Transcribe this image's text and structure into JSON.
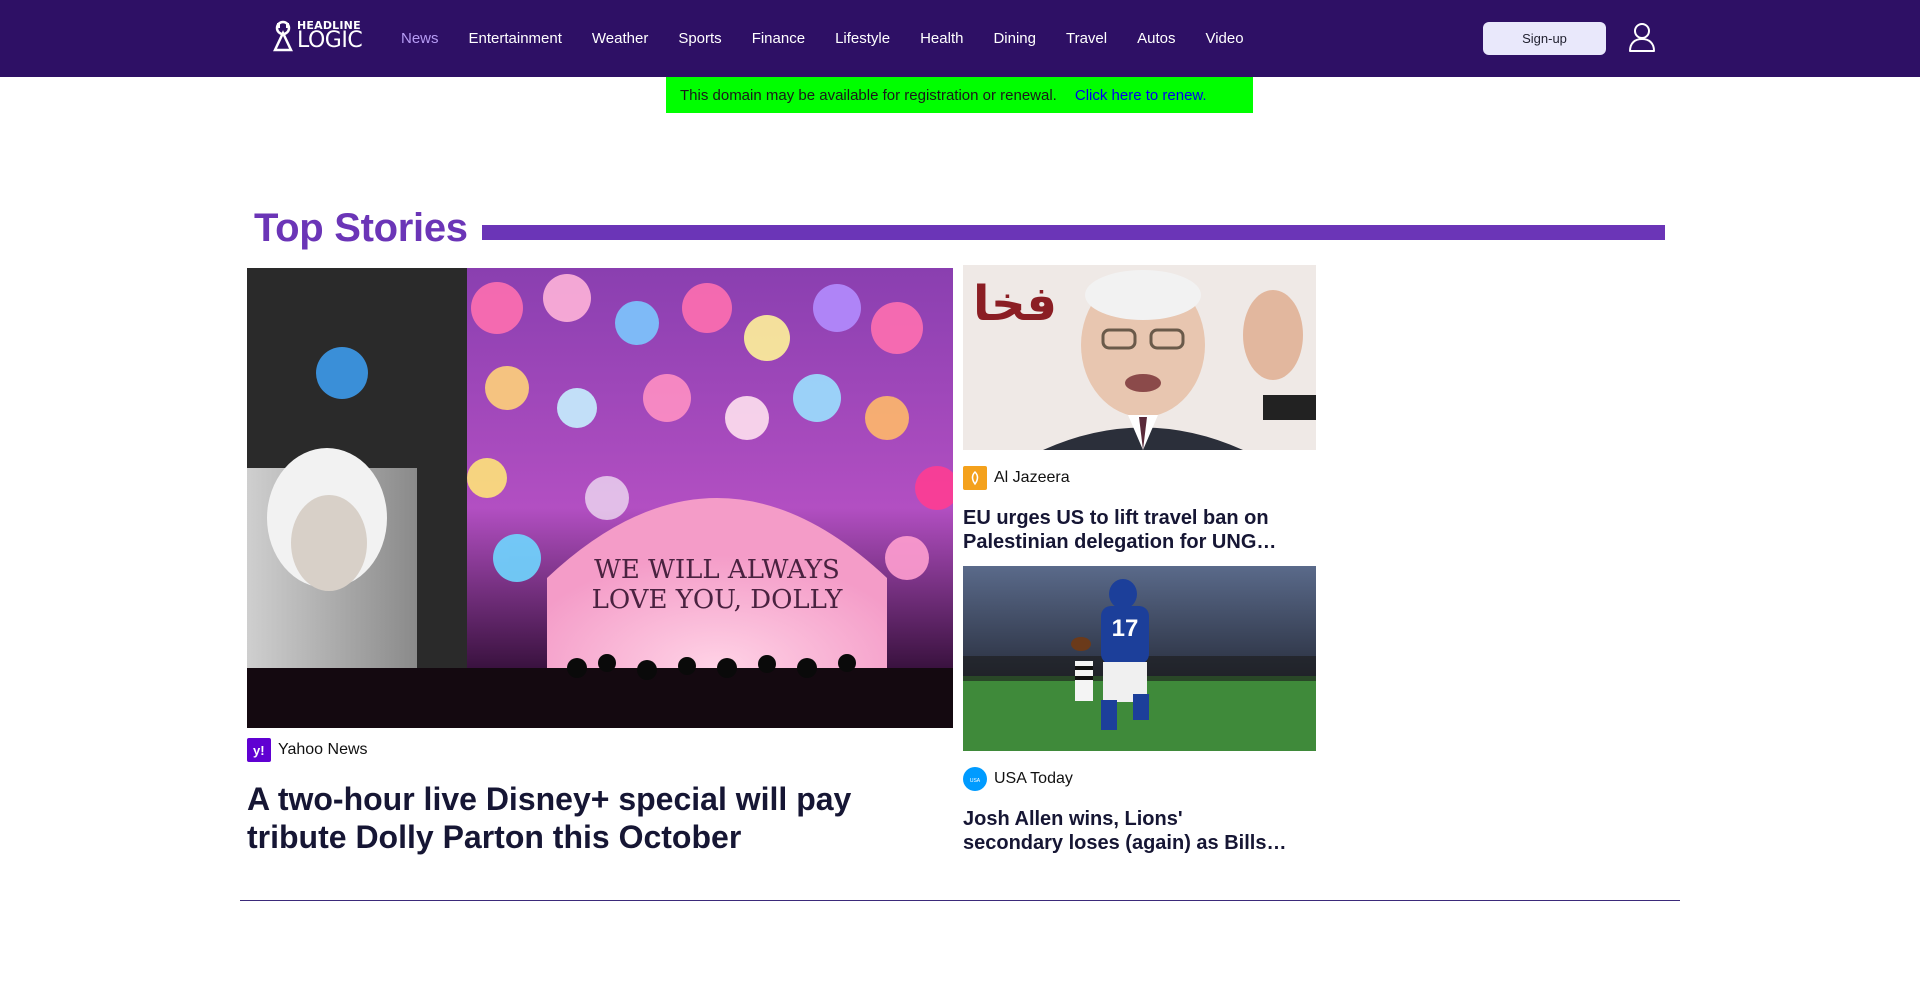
{
  "header": {
    "logo_top": "HEADLINE",
    "logo_bottom": "LOGIC",
    "nav": [
      {
        "label": "News",
        "active": true
      },
      {
        "label": "Entertainment"
      },
      {
        "label": "Weather"
      },
      {
        "label": "Sports"
      },
      {
        "label": "Finance"
      },
      {
        "label": "Lifestyle"
      },
      {
        "label": "Health"
      },
      {
        "label": "Dining"
      },
      {
        "label": "Travel"
      },
      {
        "label": "Autos"
      },
      {
        "label": "Video"
      }
    ],
    "signup_label": "Sign-up",
    "user_icon": "user-icon"
  },
  "banner": {
    "text": "This domain may be available for registration or renewal.",
    "link": "Click here to renew."
  },
  "section": {
    "title": "Top Stories"
  },
  "stories": {
    "main": {
      "source": "Yahoo News",
      "headline_line1": "A two-hour live Disney+ special will pay",
      "headline_line2": "tribute Dolly Parton this October",
      "image_text_1": "WE WILL ALWAYS",
      "image_text_2": "LOVE YOU, DOLLY"
    },
    "side1": {
      "source": "Al Jazeera",
      "headline_line1": "EU urges US to lift travel ban on",
      "headline_line2": "Palestinian delegation for UNG…"
    },
    "side2": {
      "source": "USA Today",
      "headline_line1": "Josh Allen wins, Lions'",
      "headline_line2": "secondary loses (again) as Bills…",
      "jersey_number": "17"
    }
  },
  "colors": {
    "header_bg": "#2e1065",
    "accent": "#6b35b7",
    "banner_bg": "#00ff00",
    "nav_active": "#b69cf4"
  }
}
